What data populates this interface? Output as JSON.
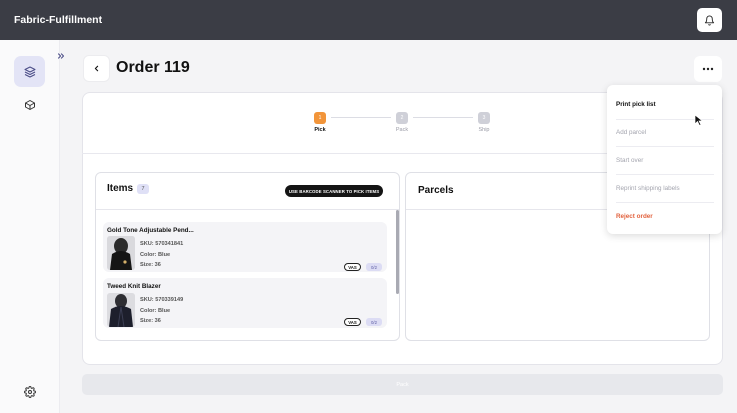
{
  "app": {
    "title": "Fabric-Fulfillment"
  },
  "icons": {
    "bell": "bell-icon",
    "layers": "layers-icon",
    "box": "box-icon",
    "settings": "gear-icon",
    "expand": "chevrons-right-icon",
    "back": "chevron-left-icon",
    "more": "more-horizontal-icon"
  },
  "page": {
    "title": "Order 119"
  },
  "stepper": {
    "steps": [
      {
        "number": "1",
        "label": "Pick"
      },
      {
        "number": "2",
        "label": "Pack"
      },
      {
        "number": "3",
        "label": "Ship"
      }
    ],
    "accent_color": "#f2953a"
  },
  "items_panel": {
    "title": "Items",
    "count": "7",
    "scan_button": "USE BARCODE SCANNER TO PICK ITEMS",
    "items": [
      {
        "name": "Gold Tone Adjustable Pend...",
        "sku": "SKU: 570341841",
        "color": "Color: Blue",
        "size": "Size: 36",
        "vas": "VAS",
        "qty": "0/2"
      },
      {
        "name": "Tweed Knit Blazer",
        "sku": "SKU: 570339149",
        "color": "Color: Blue",
        "size": "Size: 36",
        "vas": "VAS",
        "qty": "0/2"
      }
    ]
  },
  "parcels_panel": {
    "title": "Parcels"
  },
  "footer": {
    "pack_button": "Pack"
  },
  "menu": {
    "items": [
      {
        "label": "Print pick list"
      },
      {
        "label": "Add parcel"
      },
      {
        "label": "Start over"
      },
      {
        "label": "Reprint shipping labels"
      },
      {
        "label": "Reject order"
      }
    ],
    "danger_color": "#e2623e"
  }
}
